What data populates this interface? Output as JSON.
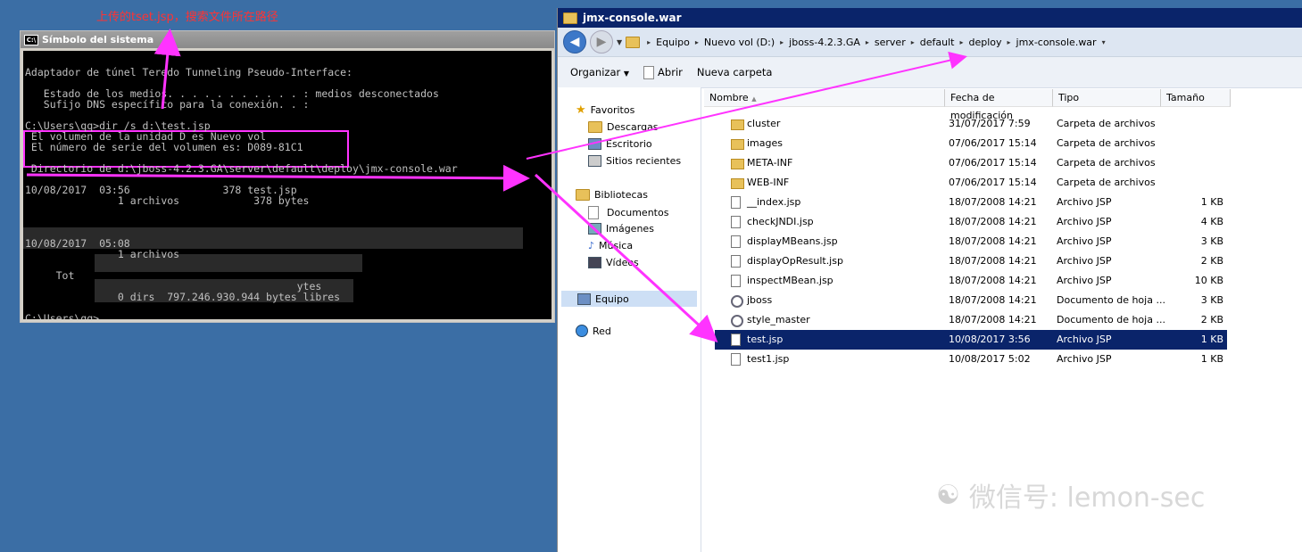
{
  "annotation_text": "上传的tset.jsp，搜索文件所在路径",
  "cmd": {
    "title": "Símbolo del sistema",
    "icon": "cmd-icon",
    "lines": [
      "Adaptador de túnel Teredo Tunneling Pseudo-Interface:",
      "",
      "   Estado de los medios. . . . . . . . . . . : medios desconectados",
      "   Sufijo DNS específico para la conexión. . :",
      "",
      "C:\\Users\\qq>dir /s d:\\test.jsp",
      " El volumen de la unidad D es Nuevo vol",
      " El número de serie del volumen es: D089-81C1",
      "",
      " Directorio de d:\\jboss-4.2.3.GA\\server\\default\\deploy\\jmx-console.war",
      "",
      "10/08/2017  03:56               378 test.jsp",
      "               1 archivos            378 bytes",
      "",
      "",
      "",
      "10/08/2017  05:08",
      "               1 archivos",
      "",
      "     Tot",
      "                                            ytes",
      "               0 dirs  797.246.930.944 bytes libres",
      "",
      "C:\\Users\\qq>"
    ]
  },
  "explorer": {
    "title": "jmx-console.war",
    "breadcrumb": [
      "Equipo",
      "Nuevo vol (D:)",
      "jboss-4.2.3.GA",
      "server",
      "default",
      "deploy",
      "jmx-console.war"
    ],
    "toolbar": {
      "organize": "Organizar",
      "open": "Abrir",
      "new_folder": "Nueva carpeta"
    },
    "nav": {
      "favorites": "Favoritos",
      "downloads": "Descargas",
      "desktop": "Escritorio",
      "recent": "Sitios recientes",
      "libraries": "Bibliotecas",
      "documents": "Documentos",
      "images": "Imágenes",
      "music": "Música",
      "videos": "Vídeos",
      "computer": "Equipo",
      "network": "Red"
    },
    "columns": {
      "name": "Nombre",
      "date": "Fecha de modificación",
      "type": "Tipo",
      "size": "Tamaño"
    },
    "files": [
      {
        "name": "cluster",
        "date": "31/07/2017 7:59",
        "type": "Carpeta de archivos",
        "size": "",
        "icon": "folder"
      },
      {
        "name": "images",
        "date": "07/06/2017 15:14",
        "type": "Carpeta de archivos",
        "size": "",
        "icon": "folder"
      },
      {
        "name": "META-INF",
        "date": "07/06/2017 15:14",
        "type": "Carpeta de archivos",
        "size": "",
        "icon": "folder"
      },
      {
        "name": "WEB-INF",
        "date": "07/06/2017 15:14",
        "type": "Carpeta de archivos",
        "size": "",
        "icon": "folder"
      },
      {
        "name": "__index.jsp",
        "date": "18/07/2008 14:21",
        "type": "Archivo JSP",
        "size": "1 KB",
        "icon": "file"
      },
      {
        "name": "checkJNDI.jsp",
        "date": "18/07/2008 14:21",
        "type": "Archivo JSP",
        "size": "4 KB",
        "icon": "file"
      },
      {
        "name": "displayMBeans.jsp",
        "date": "18/07/2008 14:21",
        "type": "Archivo JSP",
        "size": "3 KB",
        "icon": "file"
      },
      {
        "name": "displayOpResult.jsp",
        "date": "18/07/2008 14:21",
        "type": "Archivo JSP",
        "size": "2 KB",
        "icon": "file"
      },
      {
        "name": "inspectMBean.jsp",
        "date": "18/07/2008 14:21",
        "type": "Archivo JSP",
        "size": "10 KB",
        "icon": "file"
      },
      {
        "name": "jboss",
        "date": "18/07/2008 14:21",
        "type": "Documento de hoja ...",
        "size": "3 KB",
        "icon": "gear"
      },
      {
        "name": "style_master",
        "date": "18/07/2008 14:21",
        "type": "Documento de hoja ...",
        "size": "2 KB",
        "icon": "gear"
      },
      {
        "name": "test.jsp",
        "date": "10/08/2017 3:56",
        "type": "Archivo JSP",
        "size": "1 KB",
        "icon": "file",
        "selected": true
      },
      {
        "name": "test1.jsp",
        "date": "10/08/2017 5:02",
        "type": "Archivo JSP",
        "size": "1 KB",
        "icon": "file"
      }
    ]
  },
  "watermark": "微信号: lemon-sec",
  "colors": {
    "annotation": "#ff33ff",
    "desktop": "#3b6ea5",
    "selection": "#0a246a"
  }
}
